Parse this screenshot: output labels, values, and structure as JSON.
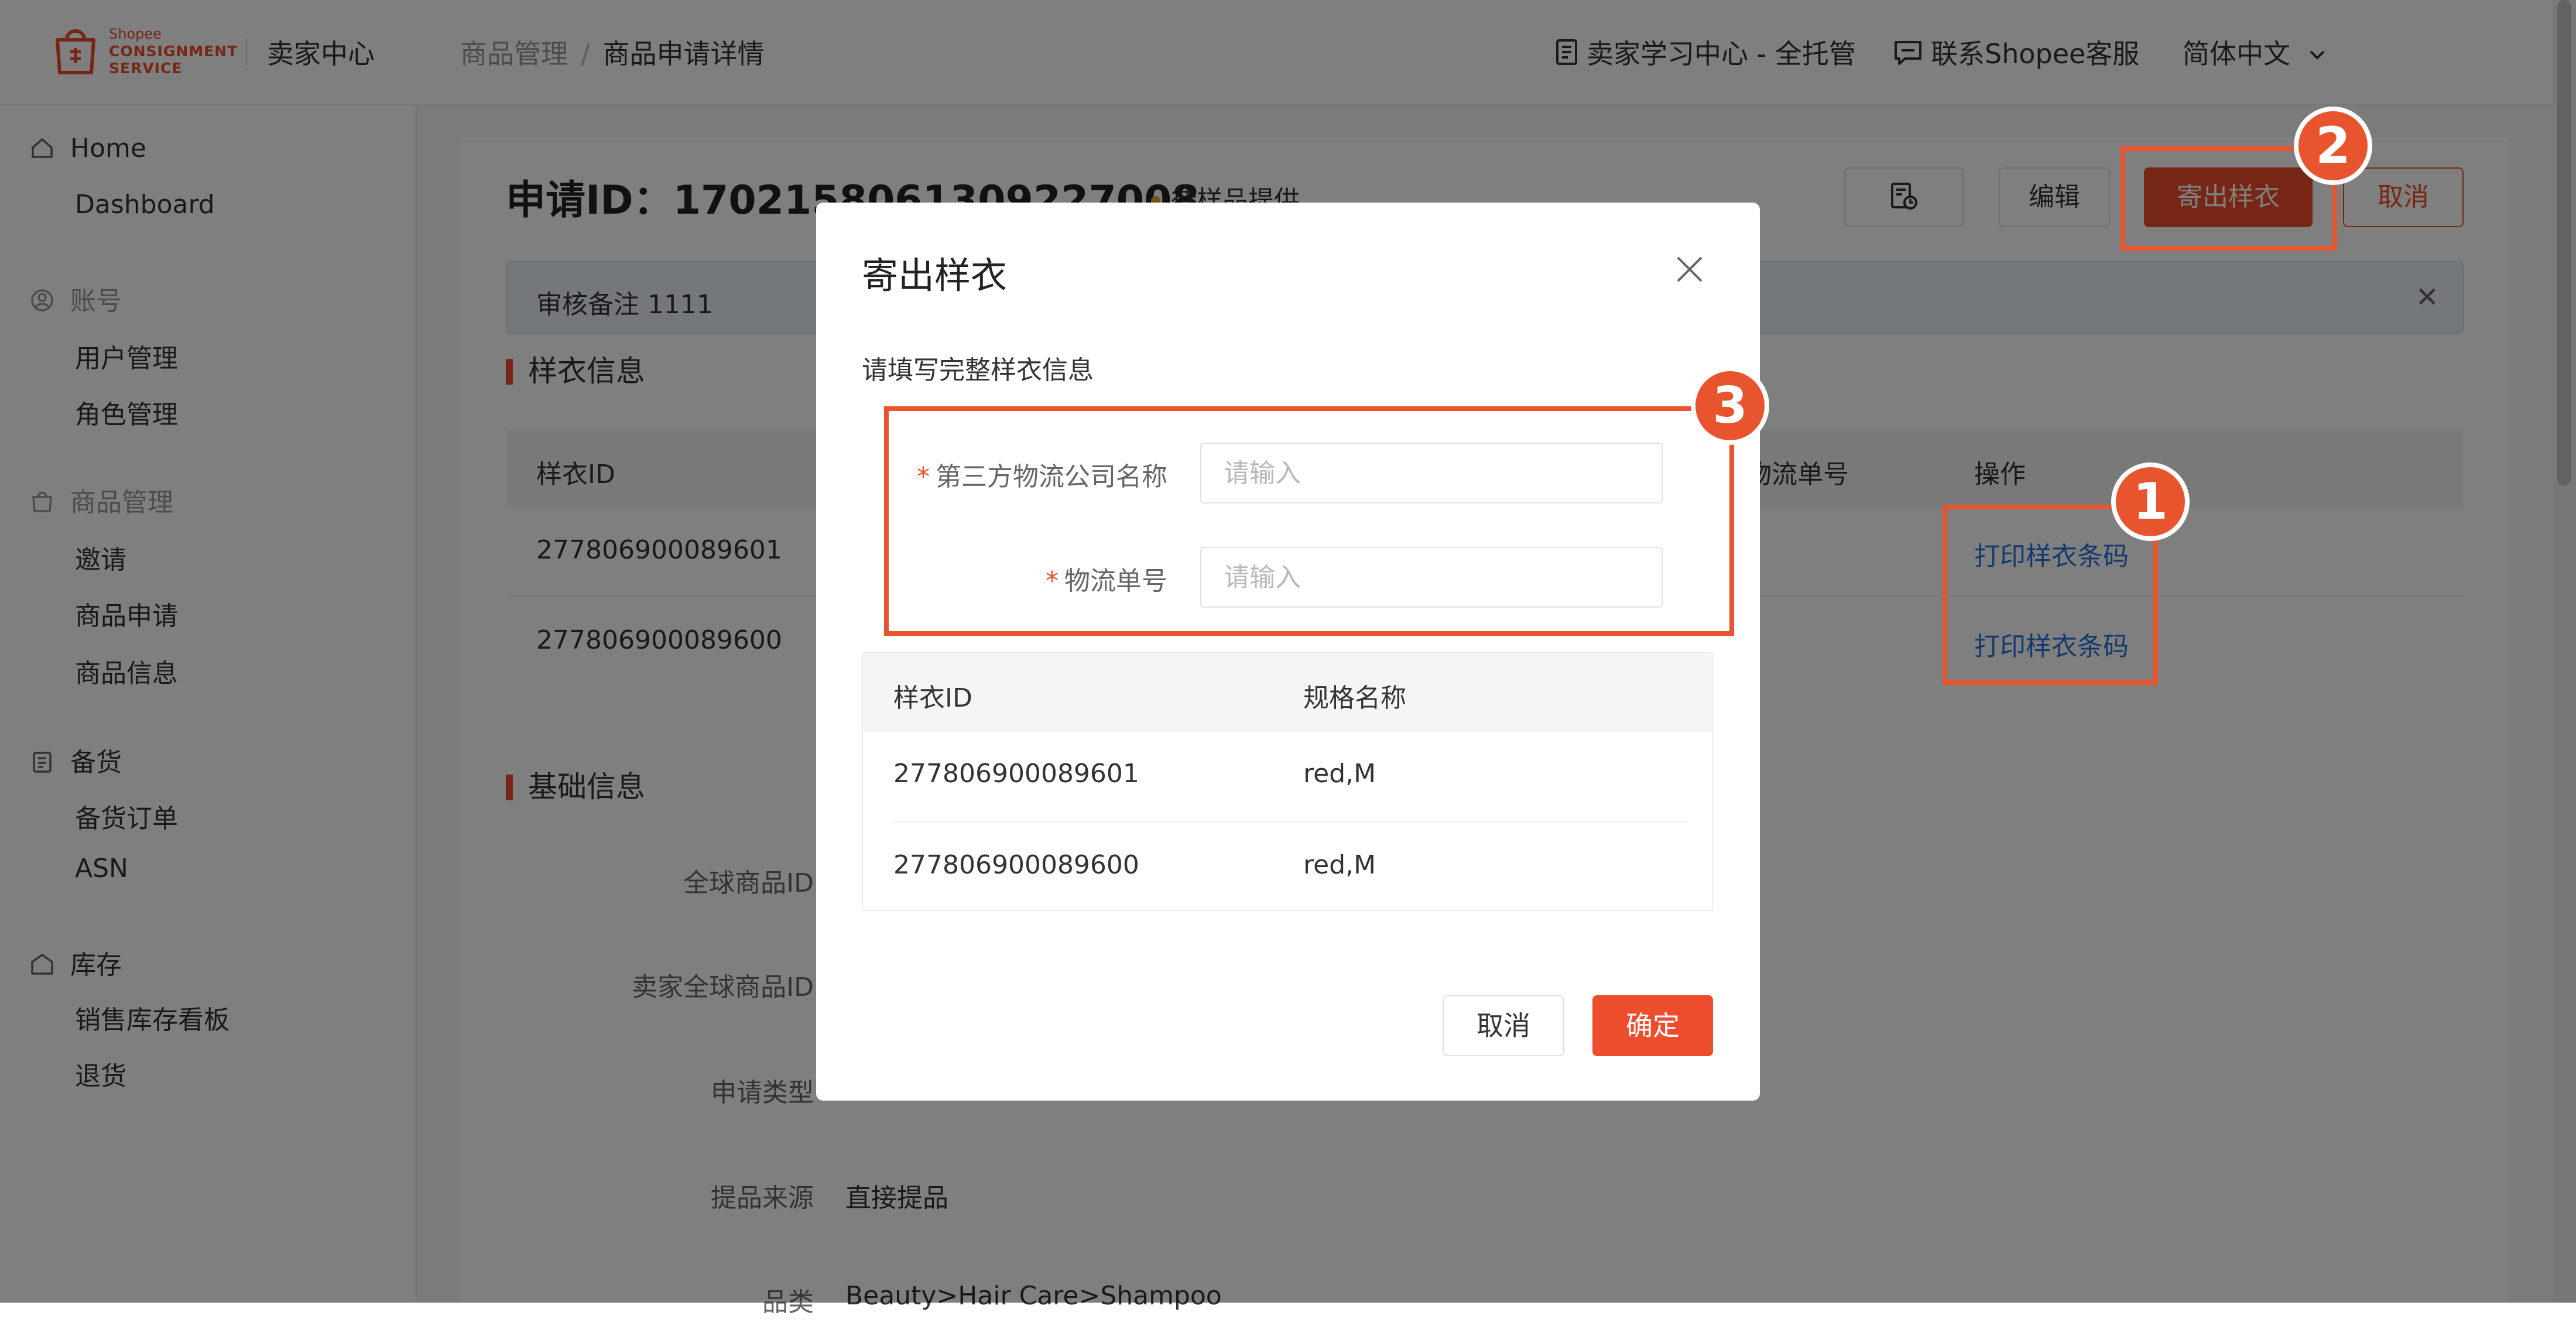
{
  "brand": {
    "logo_small": "Shopee",
    "logo_line1": "CONSIGNMENT",
    "logo_line2": "SERVICE",
    "seller_center": "卖家中心",
    "accent_color": "#ee4d2d",
    "logo_icon": "shopping-bag-icon"
  },
  "breadcrumb": {
    "parent": "商品管理",
    "separator": "/",
    "current": "商品申请详情"
  },
  "top_actions": {
    "learning_center": "卖家学习中心 - 全托管",
    "contact_support": "联系Shopee客服",
    "language": "简体中文"
  },
  "sidebar": {
    "groups": [
      {
        "label": "Home",
        "icon": "home-icon",
        "items": [
          "Dashboard"
        ]
      },
      {
        "label": "账号",
        "icon": "user-icon",
        "items": [
          "用户管理",
          "角色管理"
        ]
      },
      {
        "label": "商品管理",
        "icon": "shopping-bag-icon",
        "items": [
          "邀请",
          "商品申请",
          "商品信息"
        ]
      },
      {
        "label": "备货",
        "icon": "clipboard-icon",
        "items": [
          "备货订单",
          "ASN"
        ]
      },
      {
        "label": "库存",
        "icon": "warehouse-icon",
        "items": [
          "销售库存看板",
          "退货"
        ]
      }
    ]
  },
  "page": {
    "title": "申请ID：1702158061309227008",
    "status": "待样品提供",
    "buttons": {
      "edit": "编辑",
      "send_sample": "寄出样衣",
      "cancel": "取消"
    },
    "review_note": "审核备注 1111",
    "sample_section_title": "样衣信息",
    "sample_table": {
      "headers": {
        "sample_id": "样衣ID",
        "tracking_no": "物流单号",
        "actions": "操作"
      },
      "rows": [
        {
          "sample_id": "277806900089601",
          "action": "打印样衣条码"
        },
        {
          "sample_id": "277806900089600",
          "action": "打印样衣条码"
        }
      ]
    },
    "basic_section_title": "基础信息",
    "basic_fields": [
      {
        "label": "全球商品ID",
        "value": ""
      },
      {
        "label": "卖家全球商品ID",
        "value": ""
      },
      {
        "label": "申请类型",
        "value": ""
      },
      {
        "label": "提品来源",
        "value": "直接提品"
      },
      {
        "label": "品类",
        "value": "Beauty>Hair Care>Shampoo"
      }
    ]
  },
  "modal": {
    "title": "寄出样衣",
    "subtitle": "请填写完整样衣信息",
    "fields": {
      "logistics_company": {
        "label": "第三方物流公司名称",
        "placeholder": "请输入",
        "value": ""
      },
      "tracking_number": {
        "label": "物流单号",
        "placeholder": "请输入",
        "value": ""
      }
    },
    "table": {
      "headers": {
        "sample_id": "样衣ID",
        "spec_name": "规格名称"
      },
      "rows": [
        {
          "sample_id": "277806900089601",
          "spec": "red,M"
        },
        {
          "sample_id": "277806900089600",
          "spec": "red,M"
        }
      ]
    },
    "buttons": {
      "cancel": "取消",
      "confirm": "确定"
    }
  },
  "annotations": {
    "color": "#e8542d",
    "step_1": "1",
    "step_2": "2",
    "step_3": "3"
  }
}
